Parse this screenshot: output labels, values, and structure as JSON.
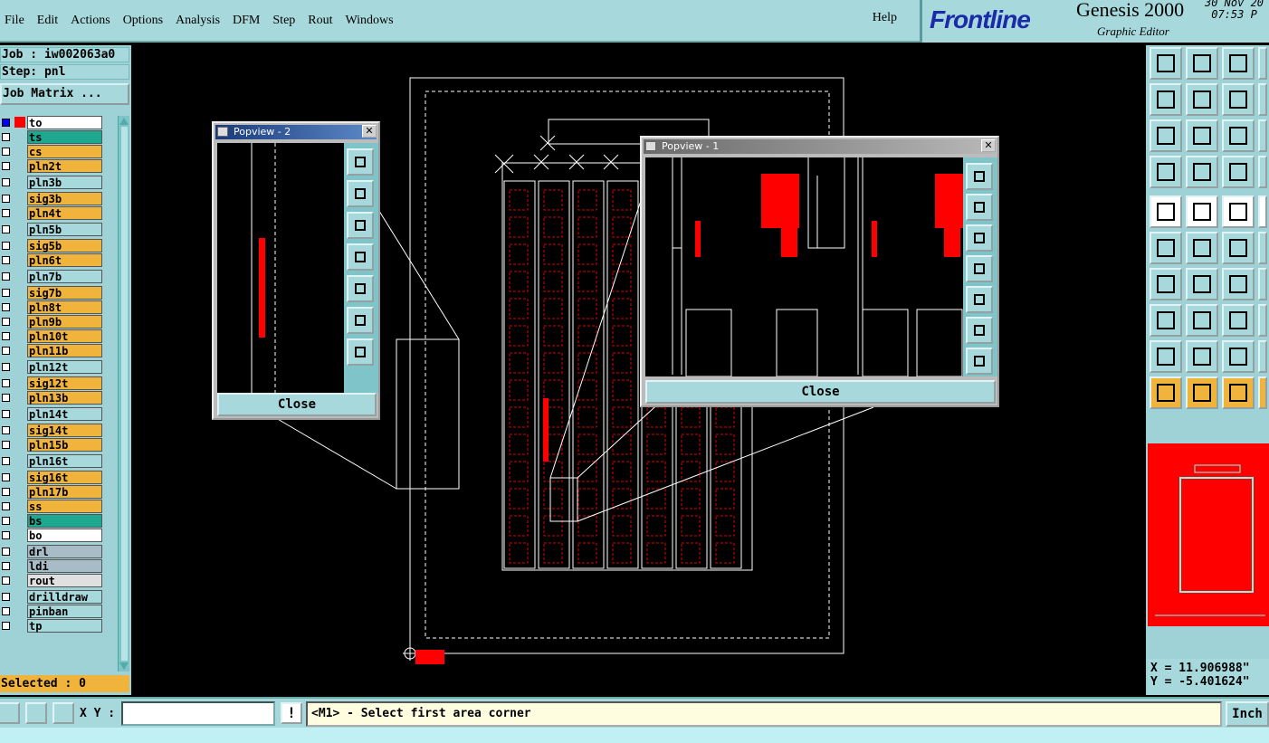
{
  "menubar": {
    "items": [
      "File",
      "Edit",
      "Actions",
      "Options",
      "Analysis",
      "DFM",
      "Step",
      "Rout",
      "Windows"
    ],
    "help": "Help"
  },
  "brand": {
    "logo": "Frontline",
    "product": "Genesis 2000",
    "subtitle": "Graphic Editor",
    "date": "30 Nov 20",
    "time": "07:53 P"
  },
  "job": {
    "job_label": "Job : iw002063a0",
    "step_label": "Step: pnl",
    "matrix_button": "Job Matrix ..."
  },
  "layers": [
    {
      "name": "to",
      "color": "#ffffff",
      "active": true
    },
    {
      "name": "ts",
      "color": "#1fa890"
    },
    {
      "name": "cs",
      "color": "#f0b43c"
    },
    {
      "name": "pln2t",
      "color": "#f0b43c"
    },
    {
      "name": "pln3b",
      "color": "#a6d8dc"
    },
    {
      "name": "sig3b",
      "color": "#f0b43c"
    },
    {
      "name": "pln4t",
      "color": "#f0b43c"
    },
    {
      "name": "pln5b",
      "color": "#a6d8dc"
    },
    {
      "name": "sig5b",
      "color": "#f0b43c"
    },
    {
      "name": "pln6t",
      "color": "#f0b43c"
    },
    {
      "name": "pln7b",
      "color": "#a6d8dc"
    },
    {
      "name": "sig7b",
      "color": "#f0b43c"
    },
    {
      "name": "pln8t",
      "color": "#f0b43c"
    },
    {
      "name": "pln9b",
      "color": "#f0b43c"
    },
    {
      "name": "pln10t",
      "color": "#f0b43c"
    },
    {
      "name": "pln11b",
      "color": "#f0b43c"
    },
    {
      "name": "pln12t",
      "color": "#a6d8dc"
    },
    {
      "name": "sig12t",
      "color": "#f0b43c"
    },
    {
      "name": "pln13b",
      "color": "#f0b43c"
    },
    {
      "name": "pln14t",
      "color": "#a6d8dc"
    },
    {
      "name": "sig14t",
      "color": "#f0b43c"
    },
    {
      "name": "pln15b",
      "color": "#f0b43c"
    },
    {
      "name": "pln16t",
      "color": "#a6d8dc"
    },
    {
      "name": "sig16t",
      "color": "#f0b43c"
    },
    {
      "name": "pln17b",
      "color": "#f0b43c"
    },
    {
      "name": "ss",
      "color": "#f0b43c"
    },
    {
      "name": "bs",
      "color": "#1fa890"
    },
    {
      "name": "bo",
      "color": "#ffffff"
    },
    {
      "name": "drl",
      "color": "#a8bcc8"
    },
    {
      "name": "ldi",
      "color": "#a8bcc8"
    },
    {
      "name": "rout",
      "color": "#e0e0e0"
    },
    {
      "name": "drilldraw",
      "color": "#a6d8dc"
    },
    {
      "name": "pinban",
      "color": "#a6d8dc"
    },
    {
      "name": "tp",
      "color": "#a6d8dc"
    }
  ],
  "selected": "Selected : 0",
  "popview2": {
    "title": "Popview - 2",
    "close": "Close"
  },
  "popview1": {
    "title": "Popview - 1",
    "close": "Close"
  },
  "coords": {
    "x": "X = 11.906988\"",
    "y": "Y = -5.401624\""
  },
  "bottom": {
    "xy_label": "X Y :",
    "xy_value": "",
    "bang": "!",
    "prompt": "<M1> - Select first area corner",
    "units": "Inch"
  },
  "preview_color": "#ff0000"
}
